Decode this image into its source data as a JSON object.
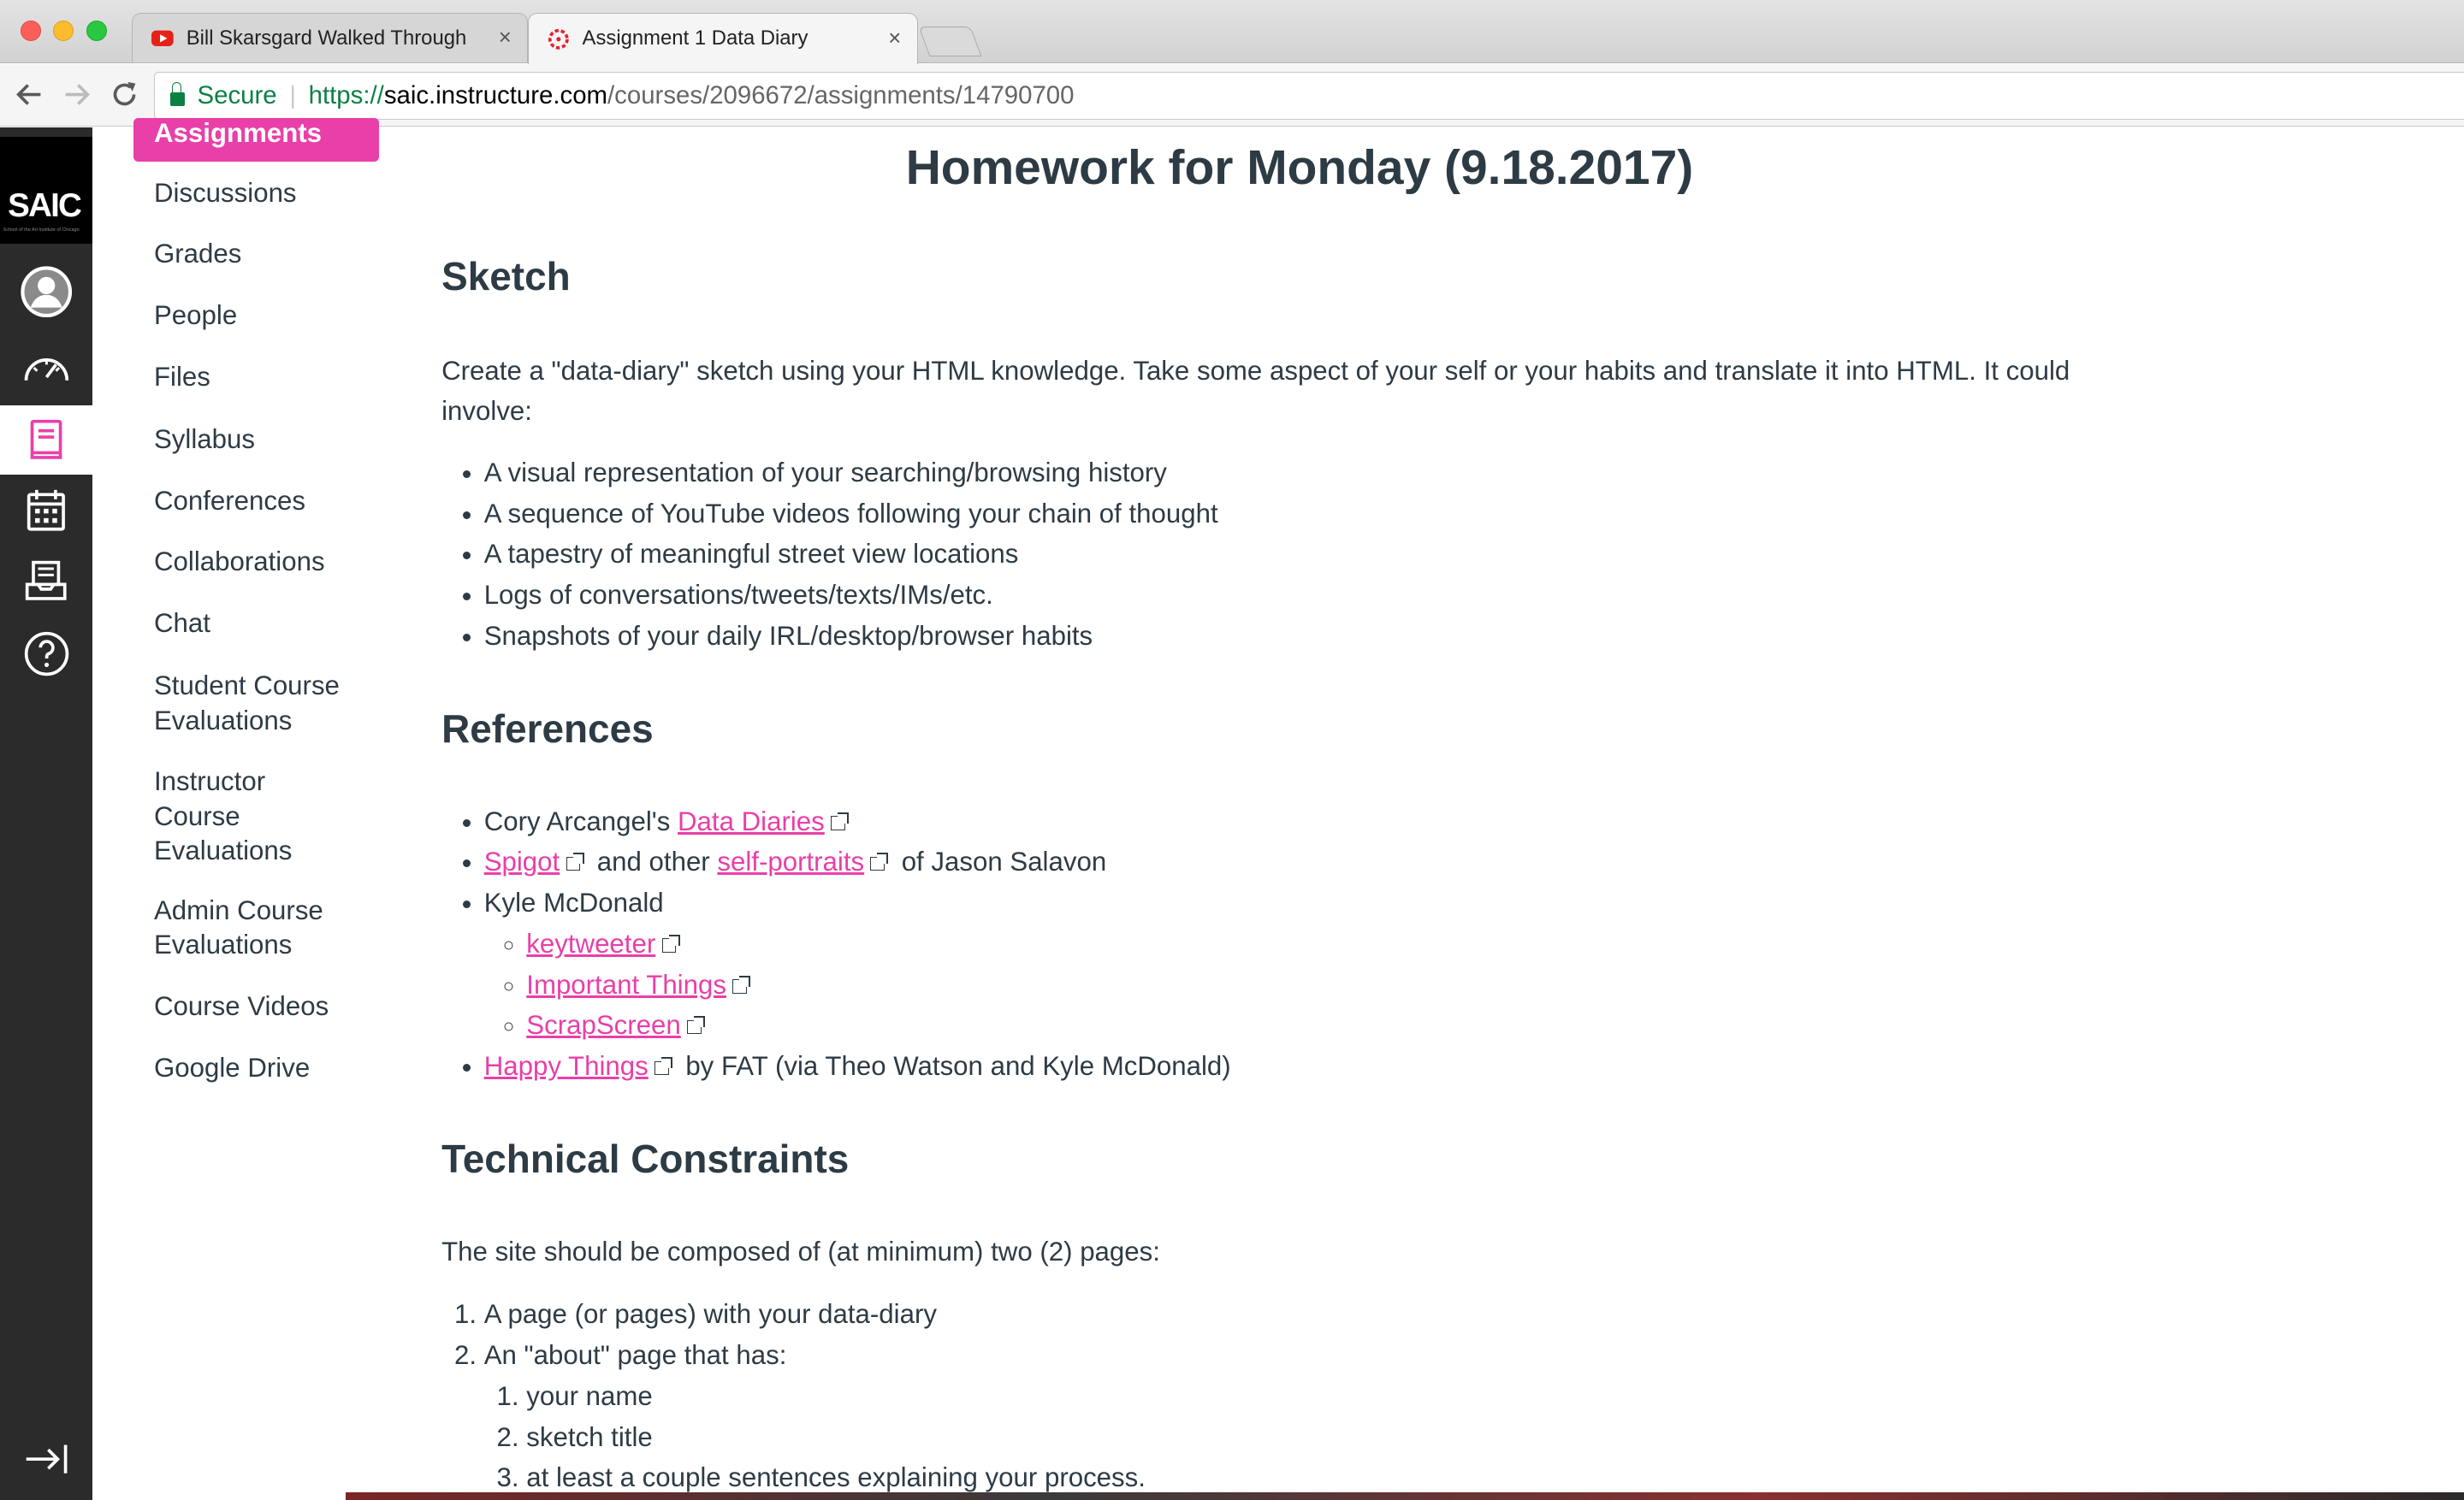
{
  "browser": {
    "tabs": [
      {
        "title": "Bill Skarsgard Walked Through",
        "close": "×"
      },
      {
        "title": "Assignment 1 Data Diary",
        "close": "×"
      }
    ],
    "address": {
      "secure_label": "Secure",
      "scheme": "https://",
      "host": "saic.instructure.com",
      "path": "/courses/2096672/assignments/14790700"
    }
  },
  "global_nav": {
    "logo_text": "SAIC",
    "logo_subtext": "School of the Art Institute of Chicago",
    "items": [
      "account-icon",
      "dashboard-icon",
      "courses-icon",
      "calendar-icon",
      "inbox-icon",
      "help-icon"
    ],
    "collapse": "collapse-nav-icon"
  },
  "course_nav": {
    "active": "Assignments",
    "links": [
      "Discussions",
      "Grades",
      "People",
      "Files",
      "Syllabus",
      "Conferences",
      "Collaborations",
      "Chat",
      "Student Course Evaluations",
      "Instructor Course Evaluations",
      "Admin Course Evaluations",
      "Course Videos",
      "Google Drive"
    ]
  },
  "content": {
    "title": "Homework for Monday (9.18.2017)",
    "sketch": {
      "heading": "Sketch",
      "intro": "Create a \"data-diary\" sketch using your HTML knowledge. Take some aspect of your self or your habits and translate it into HTML. It could involve:",
      "items": [
        "A visual representation of your searching/browsing history",
        "A sequence of YouTube videos following your chain of thought",
        "A tapestry of meaningful street view locations",
        "Logs of conversations/tweets/texts/IMs/etc.",
        "Snapshots of your daily IRL/desktop/browser habits"
      ]
    },
    "references": {
      "heading": "References",
      "r1_prefix": "Cory Arcangel's ",
      "r1_link": "Data Diaries",
      "r2_link1": "Spigot",
      "r2_mid": "and other ",
      "r2_link2": "self-portraits",
      "r2_suffix": "of Jason Salavon",
      "r3": "Kyle McDonald",
      "r3_sub": [
        "keytweeter",
        "Important Things",
        "ScrapScreen"
      ],
      "r4_link": "Happy Things",
      "r4_suffix": "by FAT (via Theo Watson and Kyle McDonald)"
    },
    "technical": {
      "heading": "Technical Constraints",
      "intro": "The site should be composed of (at minimum) two (2) pages:",
      "item1": "A page (or pages) with your data-diary",
      "item2": "An \"about\" page that has:",
      "item2_sub": [
        "your name",
        "sketch title",
        "at least a couple sentences explaining your process."
      ]
    }
  },
  "colors": {
    "accent": "#e93fa8",
    "nav_bg": "#2b2b2b",
    "text": "#2d3b45"
  }
}
